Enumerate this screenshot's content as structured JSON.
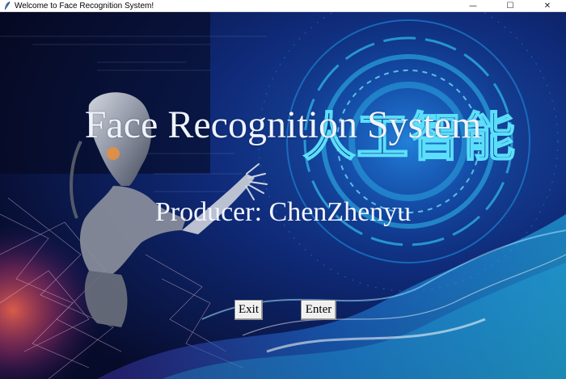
{
  "window": {
    "title": "Welcome to Face Recognition System!",
    "minimize_glyph": "—",
    "maximize_glyph": "☐",
    "close_glyph": "✕"
  },
  "main": {
    "headline": "Face Recognition System",
    "producer": "Producer: ChenZhenyu",
    "banner_text": "人工智能",
    "exit_label": "Exit",
    "enter_label": "Enter"
  },
  "colors": {
    "background_deep": "#0a1440",
    "hud_cyan": "#37d6ff",
    "hud_glow": "#1b9ad6",
    "wave_blue": "#1e6fd9",
    "warm_glow": "#ff5a4a",
    "button_face": "#f0f0f0"
  },
  "icons": {
    "app_icon": "feather-icon",
    "minimize": "minimize-icon",
    "maximize": "maximize-icon",
    "close": "close-icon"
  }
}
